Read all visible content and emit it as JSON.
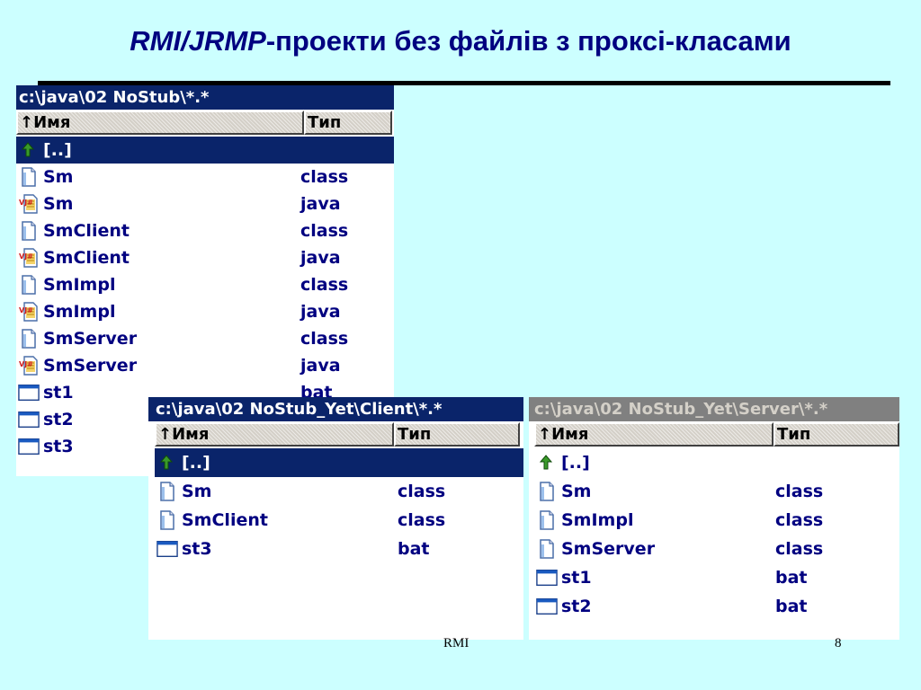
{
  "slide": {
    "title_italic": "RMI/JRMP",
    "title_rest": "-проекти без файлів з проксі-класами",
    "footer_center": "RMI",
    "page_number": "8"
  },
  "panels": [
    {
      "id": "left",
      "path": "c:\\java\\02 NoStub\\*.*",
      "header_name": "↑Имя",
      "header_type": "Тип",
      "state": "active",
      "rows": [
        {
          "name": "[..]",
          "type": "",
          "icon": "up-arrow-icon",
          "selected": true
        },
        {
          "name": "Sm",
          "type": "class",
          "icon": "file-icon"
        },
        {
          "name": "Sm",
          "type": "java",
          "icon": "java-file-icon"
        },
        {
          "name": "SmClient",
          "type": "class",
          "icon": "file-icon"
        },
        {
          "name": "SmClient",
          "type": "java",
          "icon": "java-file-icon"
        },
        {
          "name": "SmImpl",
          "type": "class",
          "icon": "file-icon"
        },
        {
          "name": "SmImpl",
          "type": "java",
          "icon": "java-file-icon"
        },
        {
          "name": "SmServer",
          "type": "class",
          "icon": "file-icon"
        },
        {
          "name": "SmServer",
          "type": "java",
          "icon": "java-file-icon"
        },
        {
          "name": "st1",
          "type": "bat",
          "icon": "batch-file-icon"
        },
        {
          "name": "st2",
          "type": "",
          "icon": "batch-file-icon"
        },
        {
          "name": "st3",
          "type": "",
          "icon": "batch-file-icon"
        }
      ]
    },
    {
      "id": "client",
      "path": "c:\\java\\02 NoStub_Yet\\Client\\*.*",
      "header_name": "↑Имя",
      "header_type": "Тип",
      "state": "active",
      "rows": [
        {
          "name": "[..]",
          "type": "",
          "icon": "up-arrow-icon",
          "selected": true
        },
        {
          "name": "Sm",
          "type": "class",
          "icon": "file-icon"
        },
        {
          "name": "SmClient",
          "type": "class",
          "icon": "file-icon"
        },
        {
          "name": "st3",
          "type": "bat",
          "icon": "batch-file-icon"
        }
      ]
    },
    {
      "id": "server",
      "path": "c:\\java\\02 NoStub_Yet\\Server\\*.*",
      "header_name": "↑Имя",
      "header_type": "Тип",
      "state": "inactive",
      "rows": [
        {
          "name": "[..]",
          "type": "",
          "icon": "up-arrow-icon",
          "selected": false
        },
        {
          "name": "Sm",
          "type": "class",
          "icon": "file-icon"
        },
        {
          "name": "SmImpl",
          "type": "class",
          "icon": "file-icon"
        },
        {
          "name": "SmServer",
          "type": "class",
          "icon": "file-icon"
        },
        {
          "name": "st1",
          "type": "bat",
          "icon": "batch-file-icon"
        },
        {
          "name": "st2",
          "type": "bat",
          "icon": "batch-file-icon"
        }
      ]
    }
  ]
}
